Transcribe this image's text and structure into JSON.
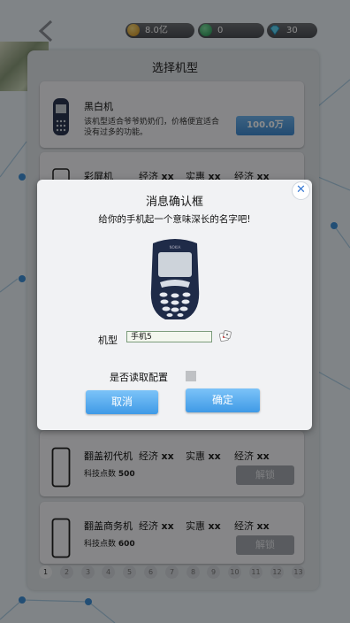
{
  "resources": {
    "gold": "8.0亿",
    "green": "0",
    "gem": "30"
  },
  "panel": {
    "title": "选择机型"
  },
  "cards": {
    "card1": {
      "name": "黑白机",
      "desc_line1": "该机型适合爷爷奶奶们，价格便宜适合",
      "desc_line2": "没有过多的功能。",
      "price": "100.0万"
    },
    "card2": {
      "name": "彩屏机",
      "stat1_label": "经济",
      "stat1_value": "xx",
      "stat2_label": "实惠",
      "stat2_value": "xx",
      "stat3_label": "经济",
      "stat3_value": "xx"
    },
    "card3": {
      "name": "翻盖初代机",
      "stat1_label": "经济",
      "stat1_value": "xx",
      "stat2_label": "实惠",
      "stat2_value": "xx",
      "stat3_label": "经济",
      "stat3_value": "xx",
      "tech_label": "科技点数",
      "tech_value": "500",
      "unlock": "解锁"
    },
    "card4": {
      "name": "翻盖商务机",
      "stat1_label": "经济",
      "stat1_value": "xx",
      "stat2_label": "实惠",
      "stat2_value": "xx",
      "stat3_label": "经济",
      "stat3_value": "xx",
      "tech_label": "科技点数",
      "tech_value": "600",
      "unlock": "解锁"
    }
  },
  "pager": [
    "1",
    "2",
    "3",
    "4",
    "5",
    "6",
    "7",
    "8",
    "9",
    "10",
    "11",
    "12",
    "13"
  ],
  "pager_active": "1",
  "dialog": {
    "title": "消息确认框",
    "subtitle": "给你的手机起一个意味深长的名字吧!",
    "close": "✕",
    "model_label": "机型",
    "name_value": "手机5",
    "config_label": "是否读取配置",
    "config_checked": false,
    "cancel": "取消",
    "confirm": "确定"
  },
  "colors": {
    "accent": "#3f9ae6",
    "disabled": "#a3a7ad"
  }
}
